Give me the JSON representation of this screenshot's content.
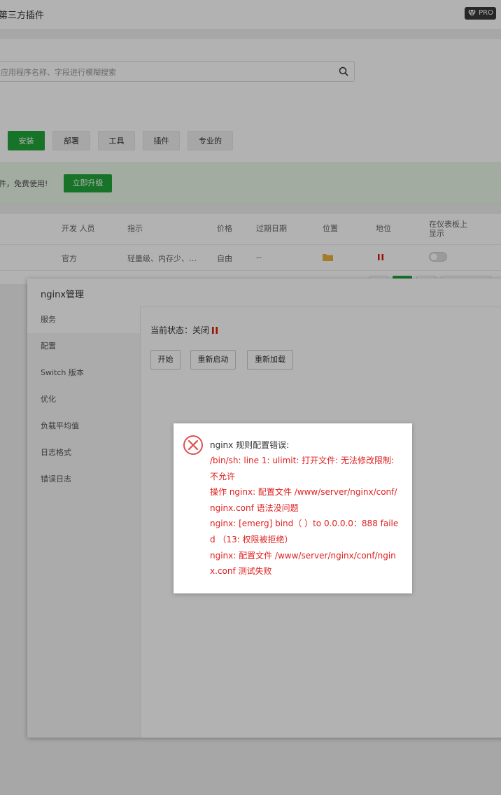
{
  "page": {
    "title": "第三方插件",
    "pro_badge": "PRO"
  },
  "search": {
    "placeholder": "应用程序名称、字段进行模糊搜索",
    "value": ""
  },
  "tabs": [
    {
      "label": "安装",
      "active": true
    },
    {
      "label": "部署",
      "active": false
    },
    {
      "label": "工具",
      "active": false
    },
    {
      "label": "插件",
      "active": false
    },
    {
      "label": "专业的",
      "active": false
    }
  ],
  "banner": {
    "text": "件，免费使用!",
    "button": "立即升级"
  },
  "table": {
    "headers": [
      "开发 人员",
      "指示",
      "价格",
      "过期日期",
      "位置",
      "地位",
      "在仪表板上显示"
    ],
    "rows": [
      {
        "developer": "官方",
        "description": "轻量级、内存少、…",
        "price": "自由",
        "expiry": "--",
        "location_icon": "folder-icon",
        "status_icon": "pause-icon",
        "dashboard_toggle": false
      }
    ]
  },
  "modal": {
    "title": "nginx管理",
    "sidebar": [
      {
        "label": "服务",
        "active": true
      },
      {
        "label": "配置",
        "active": false
      },
      {
        "label": "Switch 版本",
        "active": false
      },
      {
        "label": "优化",
        "active": false
      },
      {
        "label": "负载平均值",
        "active": false
      },
      {
        "label": "日志格式",
        "active": false
      },
      {
        "label": "错误日志",
        "active": false
      }
    ],
    "status_label": "当前状态：关闭",
    "buttons": [
      "开始",
      "重新启动",
      "重新加载"
    ]
  },
  "error_dialog": {
    "title": "nginx 规则配置错误:",
    "lines": [
      "/bin/sh:  line 1:  ulimit:  打开文件:  无法修改限制:  不允许",
      "操作 nginx:  配置文件 /www/server/nginx/conf/nginx.conf 语法没问题",
      "nginx:  [emerg] bind（ ）to 0.0.0.0：888 failed （13:  权限被拒绝）",
      "nginx:  配置文件 /www/server/nginx/conf/nginx.conf 测试失败"
    ]
  },
  "colors": {
    "accent": "#20a53a",
    "error": "#e02020",
    "status_stop": "#d81e06",
    "folder": "#e8b339"
  }
}
